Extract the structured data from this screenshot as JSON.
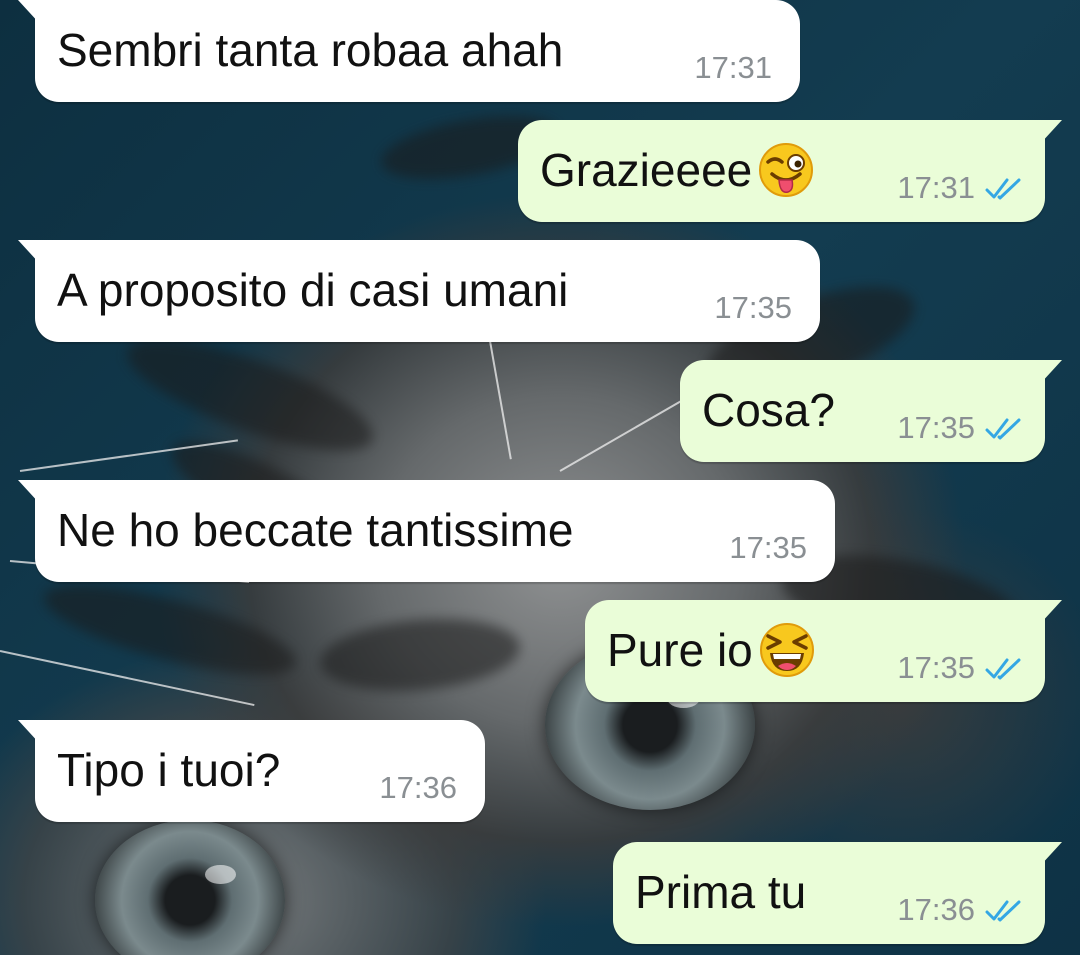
{
  "conversation": {
    "messages": [
      {
        "direction": "incoming",
        "text": "Sembri tanta robaa ahah",
        "time": "17:31"
      },
      {
        "direction": "outgoing",
        "text": "Grazieeee",
        "emoji": "winking-face-with-tongue-emoji",
        "time": "17:31",
        "status": "read-double-check"
      },
      {
        "direction": "incoming",
        "text": "A proposito di casi umani",
        "time": "17:35"
      },
      {
        "direction": "outgoing",
        "text": "Cosa?",
        "time": "17:35",
        "status": "read-double-check"
      },
      {
        "direction": "incoming",
        "text": "Ne ho beccate tantissime",
        "time": "17:35"
      },
      {
        "direction": "outgoing",
        "text": "Pure io",
        "emoji": "grinning-squinting-face-emoji",
        "time": "17:35",
        "status": "read-double-check"
      },
      {
        "direction": "incoming",
        "text": "Tipo i tuoi?",
        "time": "17:36"
      },
      {
        "direction": "outgoing",
        "text": "Prima tu",
        "time": "17:36",
        "status": "read-double-check"
      }
    ]
  },
  "colors": {
    "incoming_bubble": "#ffffff",
    "outgoing_bubble": "#eafdd8",
    "timestamp": "#8a8f93",
    "read_ticks": "#34a7e4",
    "wallpaper_background": "#0f3446"
  },
  "wallpaper": {
    "icon": "kitten-photo-wallpaper"
  }
}
